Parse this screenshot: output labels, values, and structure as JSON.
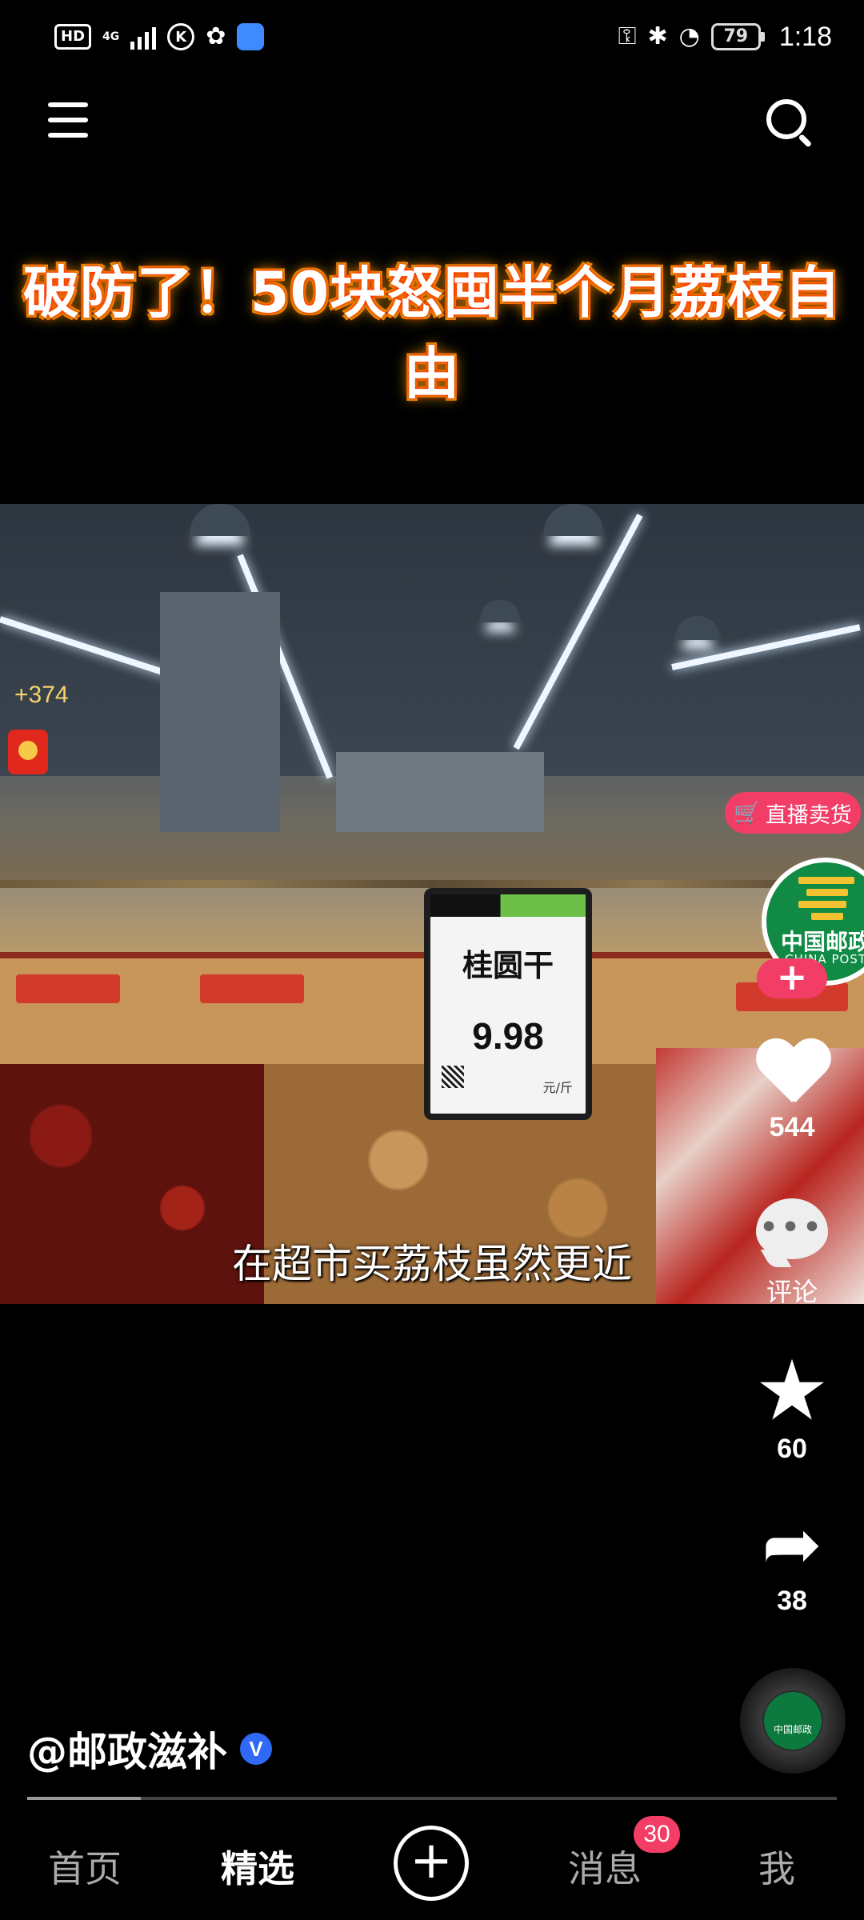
{
  "status_bar": {
    "hd": "HD",
    "network": "4G",
    "k_icon": "K",
    "battery": "79",
    "time": "1:18"
  },
  "video": {
    "title": "破防了！50块怒囤半个月荔枝自由",
    "caption": "在超市买荔枝虽然更近",
    "price_sign_name": "桂圆干",
    "price_sign_value": "9.98",
    "price_sign_unit": "元/斤"
  },
  "left_widget": {
    "bonus_count": "+374"
  },
  "side": {
    "live_badge": "直播卖货",
    "avatar_text": "中国邮政",
    "avatar_sub": "CHINA POST",
    "follow_label": "+",
    "like_count": "544",
    "comment_label": "评论",
    "favorite_count": "60",
    "share_count": "38",
    "disc_text": "中国邮政"
  },
  "author": {
    "name": "@邮政滋补",
    "verified": "V"
  },
  "playback": {
    "progress_fraction": 0.14
  },
  "bottom_nav": {
    "home": "首页",
    "featured": "精选",
    "create": "+",
    "messages": "消息",
    "messages_badge": "30",
    "me": "我"
  },
  "colors": {
    "accent_pink": "#f23d66",
    "verified_blue": "#2f69f5",
    "post_green": "#108a45"
  }
}
